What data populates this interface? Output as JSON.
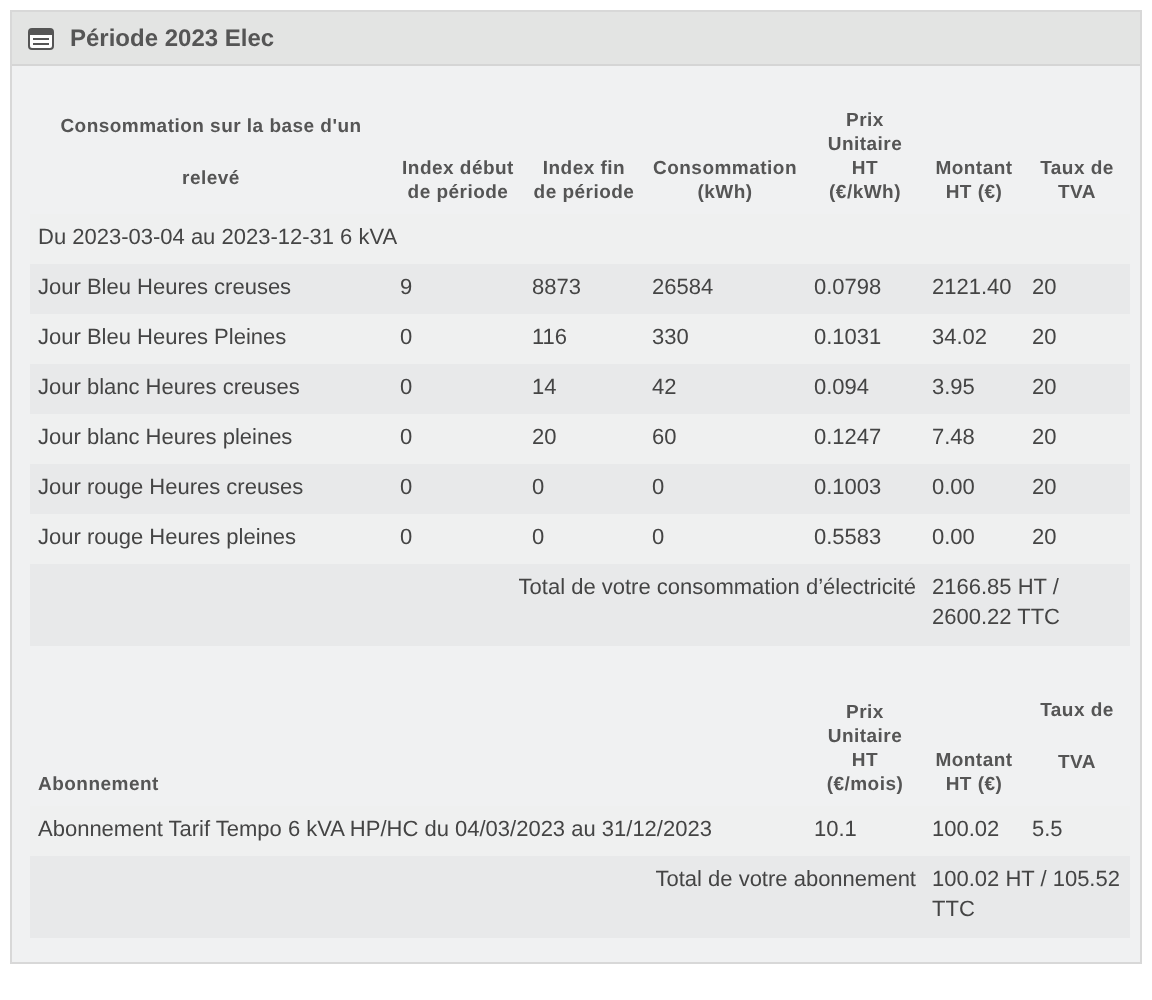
{
  "panel": {
    "title": "Période 2023 Elec"
  },
  "consumption": {
    "columns": [
      "Consommation sur la base d'un relevé",
      "Index début de période",
      "Index fin de période",
      "Consommation (kWh)",
      "Prix Unitaire HT (€/kWh)",
      "Montant HT (€)",
      "Taux de TVA"
    ],
    "period": "Du 2023-03-04 au 2023-12-31 6 kVA",
    "rows": [
      {
        "cells": [
          "Jour Bleu Heures creuses",
          "9",
          "8873",
          "26584",
          "0.0798",
          "2121.40",
          "20"
        ]
      },
      {
        "cells": [
          "Jour Bleu Heures Pleines",
          "0",
          "116",
          "330",
          "0.1031",
          "34.02",
          "20"
        ]
      },
      {
        "cells": [
          "Jour blanc Heures creuses",
          "0",
          "14",
          "42",
          "0.094",
          "3.95",
          "20"
        ]
      },
      {
        "cells": [
          "Jour blanc Heures pleines",
          "0",
          "20",
          "60",
          "0.1247",
          "7.48",
          "20"
        ]
      },
      {
        "cells": [
          "Jour rouge Heures creuses",
          "0",
          "0",
          "0",
          "0.1003",
          "0.00",
          "20"
        ]
      },
      {
        "cells": [
          "Jour rouge Heures pleines",
          "0",
          "0",
          "0",
          "0.5583",
          "0.00",
          "20"
        ]
      }
    ],
    "total": {
      "label": "Total de votre consommation d’électricité",
      "value": "2166.85 HT / 2600.22 TTC"
    }
  },
  "subscription": {
    "columns": [
      "Abonnement",
      "Prix Unitaire HT (€/mois)",
      "Montant HT (€)",
      "Taux de TVA"
    ],
    "rows": [
      {
        "cells": [
          "Abonnement Tarif Tempo 6 kVA HP/HC du 04/03/2023 au 31/12/2023",
          "10.1",
          "100.02",
          "5.5"
        ]
      }
    ],
    "total": {
      "label": "Total de votre abonnement",
      "value": "100.02 HT / 105.52 TTC"
    }
  }
}
